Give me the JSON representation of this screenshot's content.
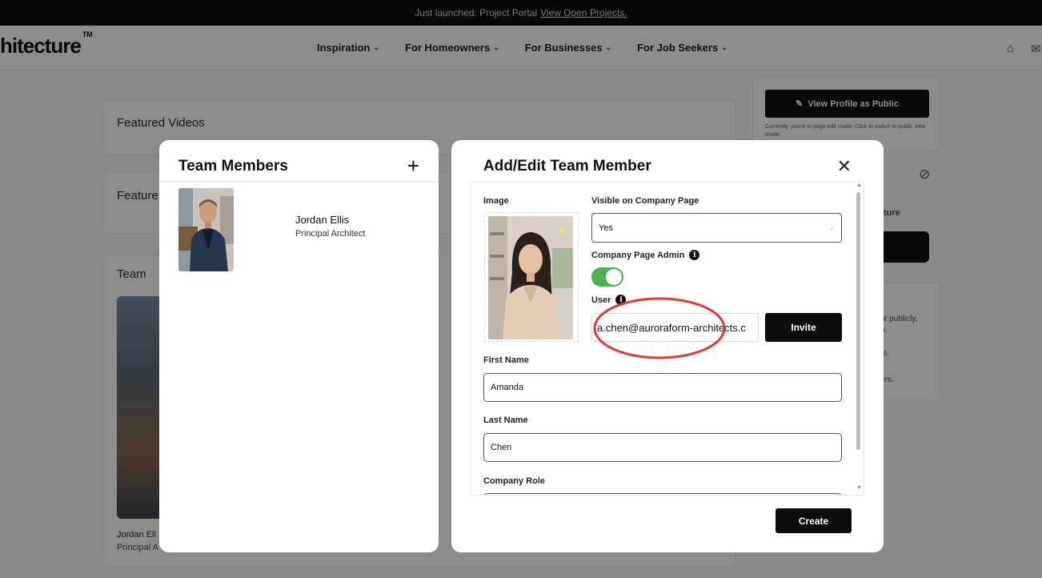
{
  "announcement": {
    "text": "Just launched: Project Portal",
    "link": "View Open Projects."
  },
  "header": {
    "logo": "hitecture",
    "logo_mark": "TM",
    "nav": [
      {
        "label": "Inspiration"
      },
      {
        "label": "For Homeowners"
      },
      {
        "label": "For Businesses"
      },
      {
        "label": "For Job Seekers"
      }
    ],
    "icons": [
      "home-icon",
      "mail-icon"
    ]
  },
  "background": {
    "featured_videos": "Featured Videos",
    "featured_partial": "Feature",
    "team_title": "Team",
    "team_member_name": "Jordan Ell",
    "team_member_role": "Principal A",
    "view_profile_button": "View Profile as Public",
    "edit_mode_note": "Currently, you're in page edit mode. Click to switch to public view mode.",
    "side_text_1": "ture",
    "side_text_2": "nt publicly,",
    "side_text_3": "n.",
    "side_text_4": "rs.",
    "side_text_5": "ers."
  },
  "team_modal": {
    "title": "Team Members",
    "add_icon": "plus-icon",
    "members": [
      {
        "name": "Jordan Ellis",
        "role": "Principal Architect"
      }
    ]
  },
  "edit_modal": {
    "title": "Add/Edit Team Member",
    "close_icon": "close-icon",
    "image_label": "Image",
    "visible_label": "Visible on Company Page",
    "visible_value": "Yes",
    "admin_label": "Company Page Admin",
    "admin_enabled": true,
    "user_label": "User",
    "user_value": "a.chen@auroraform-architects.c",
    "invite_button": "Invite",
    "first_name_label": "First Name",
    "first_name_value": "Amanda",
    "last_name_label": "Last Name",
    "last_name_value": "Chen",
    "company_role_label": "Company Role",
    "create_button": "Create"
  },
  "colors": {
    "toggle_on": "#4caf50",
    "annotation": "#e53935",
    "button": "#0c0c0c"
  }
}
